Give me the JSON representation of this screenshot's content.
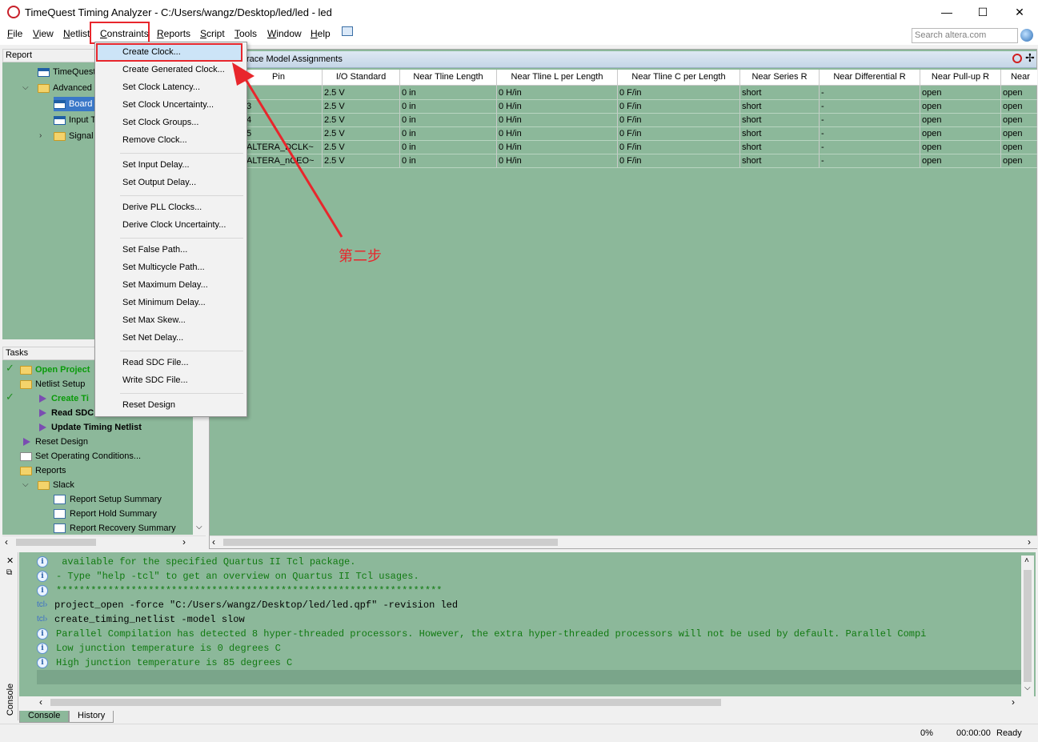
{
  "window": {
    "title": "TimeQuest Timing Analyzer - C:/Users/wangz/Desktop/led/led - led",
    "minimize": "—",
    "maximize": "☐",
    "close": "✕"
  },
  "menubar": {
    "items": [
      {
        "label": "File",
        "u": "F",
        "rest": "ile"
      },
      {
        "label": "View",
        "u": "V",
        "rest": "iew"
      },
      {
        "label": "Netlist",
        "u": "N",
        "rest": "etlist"
      },
      {
        "label": "Constraints",
        "u": "C",
        "rest": "onstraints"
      },
      {
        "label": "Reports",
        "u": "R",
        "rest": "eports"
      },
      {
        "label": "Script",
        "u": "S",
        "rest": "cript"
      },
      {
        "label": "Tools",
        "u": "T",
        "rest": "ools"
      },
      {
        "label": "Window",
        "u": "W",
        "rest": "indow"
      },
      {
        "label": "Help",
        "u": "H",
        "rest": "elp"
      }
    ],
    "search_placeholder": "Search altera.com"
  },
  "report_panel": {
    "header": "Report",
    "items": [
      "TimeQuest",
      "Advanced",
      "Board",
      "Input T",
      "Signal"
    ]
  },
  "tasks_panel": {
    "header": "Tasks",
    "items": [
      "Open Project",
      "Netlist Setup",
      "Create Ti",
      "Read SDC",
      "Update Timing Netlist",
      "Reset Design",
      "Set Operating Conditions...",
      "Reports",
      "Slack",
      "Report Setup Summary",
      "Report Hold Summary",
      "Report Recovery Summary"
    ]
  },
  "dropdown": {
    "items": [
      "Create Clock...",
      "Create Generated Clock...",
      "Set Clock Latency...",
      "Set Clock Uncertainty...",
      "Set Clock Groups...",
      "Remove Clock...",
      "Set Input Delay...",
      "Set Output Delay...",
      "Derive PLL Clocks...",
      "Derive Clock Uncertainty...",
      "Set False Path...",
      "Set Multicycle Path...",
      "Set Maximum Delay...",
      "Set Minimum Delay...",
      "Set Max Skew...",
      "Set Net Delay...",
      "Read SDC File...",
      "Write SDC File...",
      "Reset Design"
    ]
  },
  "main": {
    "title": "race Model Assignments",
    "columns": [
      "Pin",
      "I/O Standard",
      "Near Tline Length",
      "Near Tline L per Length",
      "Near Tline C per Length",
      "Near Series R",
      "Near Differential R",
      "Near Pull-up R",
      "Near"
    ],
    "rows": [
      [
        "",
        "2.5 V",
        "0 in",
        "0 H/in",
        "0 F/in",
        "short",
        "-",
        "open",
        "open"
      ],
      [
        "3",
        "2.5 V",
        "0 in",
        "0 H/in",
        "0 F/in",
        "short",
        "-",
        "open",
        "open"
      ],
      [
        "4",
        "2.5 V",
        "0 in",
        "0 H/in",
        "0 F/in",
        "short",
        "-",
        "open",
        "open"
      ],
      [
        "5",
        "2.5 V",
        "0 in",
        "0 H/in",
        "0 F/in",
        "short",
        "-",
        "open",
        "open"
      ],
      [
        "ALTERA_DCLK~",
        "2.5 V",
        "0 in",
        "0 H/in",
        "0 F/in",
        "short",
        "-",
        "open",
        "open"
      ],
      [
        "ALTERA_nCEO~",
        "2.5 V",
        "0 in",
        "0 H/in",
        "0 F/in",
        "short",
        "-",
        "open",
        "open"
      ]
    ]
  },
  "annotation": {
    "text": "第二步",
    "color": "#e8262c"
  },
  "console": {
    "lines": [
      {
        "icon": "info",
        "text": " available for the specified Quartus II Tcl package."
      },
      {
        "icon": "info",
        "text": "- Type \"help -tcl\" to get an overview on Quartus II Tcl usages."
      },
      {
        "icon": "info",
        "text": "*******************************************************************"
      },
      {
        "icon": "tcl",
        "text": "project_open -force \"C:/Users/wangz/Desktop/led/led.qpf\" -revision led"
      },
      {
        "icon": "tcl",
        "text": "create_timing_netlist -model slow"
      },
      {
        "icon": "info",
        "text": "Parallel Compilation has detected 8 hyper-threaded processors. However, the extra hyper-threaded processors will not be used by default. Parallel Compi"
      },
      {
        "icon": "info",
        "text": "Low junction temperature is 0 degrees C"
      },
      {
        "icon": "info",
        "text": "High junction temperature is 85 degrees C"
      },
      {
        "icon": "tcl",
        "text": ""
      }
    ],
    "tcl_prompt": "tcl›",
    "side_label": "Console",
    "tabs": [
      "Console",
      "History"
    ]
  },
  "status": {
    "progress": "0%",
    "time": "00:00:00",
    "state": "Ready"
  },
  "colors": {
    "panel_bg": "#8cb89a",
    "highlight_red": "#e8262c",
    "console_green": "#117a11"
  }
}
